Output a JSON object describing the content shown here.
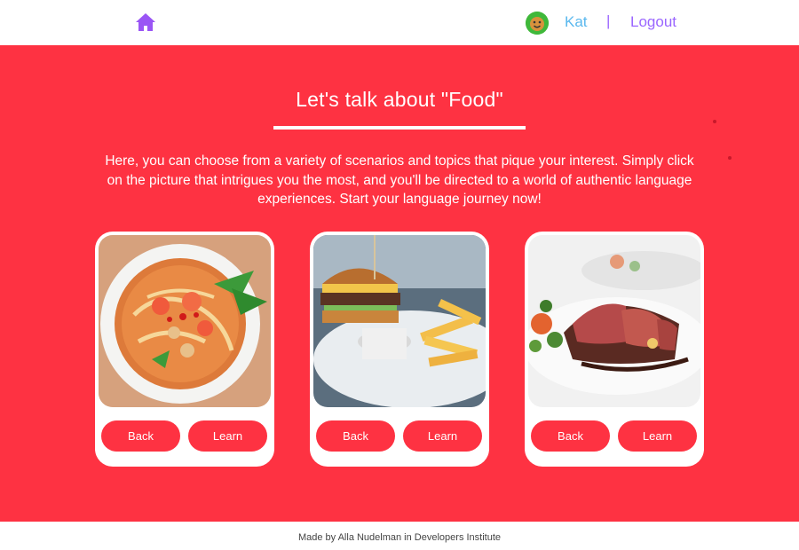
{
  "nav": {
    "home_icon": "home-icon",
    "avatar_icon": "avatar-icon",
    "user_name": "Kat",
    "separator": "|",
    "logout_label": "Logout"
  },
  "hero": {
    "title": "Let's talk about \"Food\"",
    "intro": "Here, you can choose from a variety of scenarios and topics that pique your interest. Simply click on the picture that intrigues you the most, and you'll be directed to a world of authentic language experiences. Start your language journey now!"
  },
  "cards": [
    {
      "image": "noodle-soup-image",
      "back_label": "Back",
      "learn_label": "Learn"
    },
    {
      "image": "burger-fries-image",
      "back_label": "Back",
      "learn_label": "Learn"
    },
    {
      "image": "sliced-steak-image",
      "back_label": "Back",
      "learn_label": "Learn"
    }
  ],
  "footer": {
    "text": "Made by Alla Nudelman in Developers Institute"
  },
  "colors": {
    "hero_background": "#fe3242",
    "nav_user": "#5ab8ee",
    "nav_logout": "#9a66ff",
    "button": "#fe3242",
    "card": "#ffffff"
  }
}
